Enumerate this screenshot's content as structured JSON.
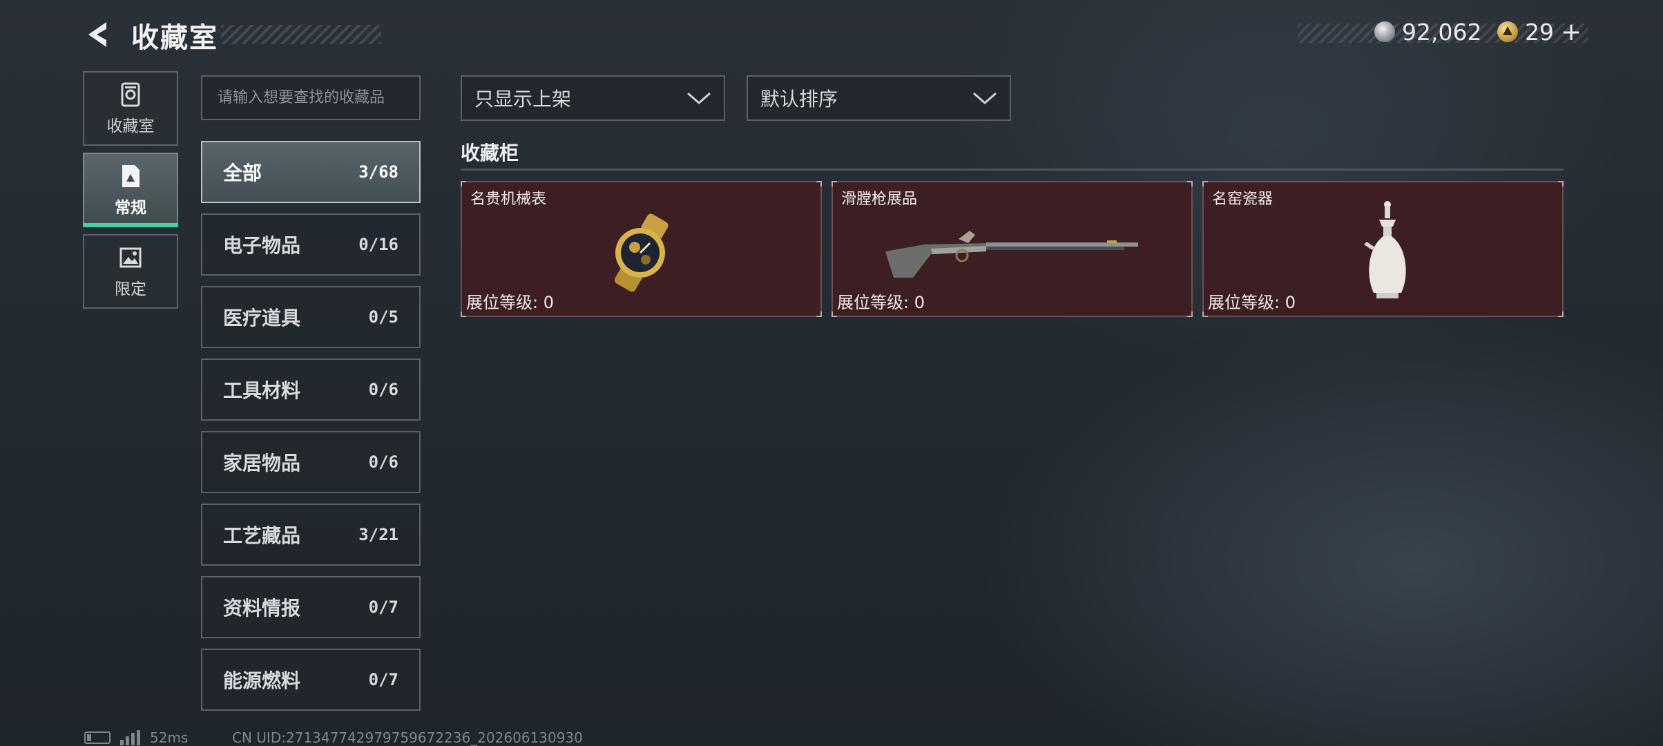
{
  "header": {
    "title": "收藏室",
    "resources": [
      {
        "icon": "coin-icon",
        "value": "92,062"
      },
      {
        "icon": "ticket-icon",
        "value": "29"
      }
    ],
    "add_label": "+"
  },
  "side_nav": {
    "tabs": [
      {
        "label": "收藏室",
        "icon": "vault-icon",
        "active": false
      },
      {
        "label": "常规",
        "icon": "document-icon",
        "active": true
      },
      {
        "label": "限定",
        "icon": "image-icon",
        "active": false
      }
    ]
  },
  "search": {
    "placeholder": "请输入想要查找的收藏品"
  },
  "categories": [
    {
      "label": "全部",
      "count": "3/68",
      "active": true
    },
    {
      "label": "电子物品",
      "count": "0/16"
    },
    {
      "label": "医疗道具",
      "count": "0/5"
    },
    {
      "label": "工具材料",
      "count": "0/6"
    },
    {
      "label": "家居物品",
      "count": "0/6"
    },
    {
      "label": "工艺藏品",
      "count": "3/21"
    },
    {
      "label": "资料情报",
      "count": "0/7"
    },
    {
      "label": "能源燃料",
      "count": "0/7"
    }
  ],
  "filters": {
    "display_filter": "只显示上架",
    "sort": "默认排序"
  },
  "cabinet": {
    "title": "收藏柜",
    "items": [
      {
        "name": "名贵机械表",
        "level_label": "展位等级:",
        "level": "0",
        "icon": "watch-icon"
      },
      {
        "name": "滑膛枪展品",
        "level_label": "展位等级:",
        "level": "0",
        "icon": "musket-icon"
      },
      {
        "name": "名窑瓷器",
        "level_label": "展位等级:",
        "level": "0",
        "icon": "vase-icon"
      }
    ]
  },
  "footer": {
    "ping": "52ms",
    "uid": "CN UID:271347742979759672236_202606130930"
  },
  "colors": {
    "accent_green": "#4ccf9a",
    "card_bg": "#3d1f23"
  }
}
